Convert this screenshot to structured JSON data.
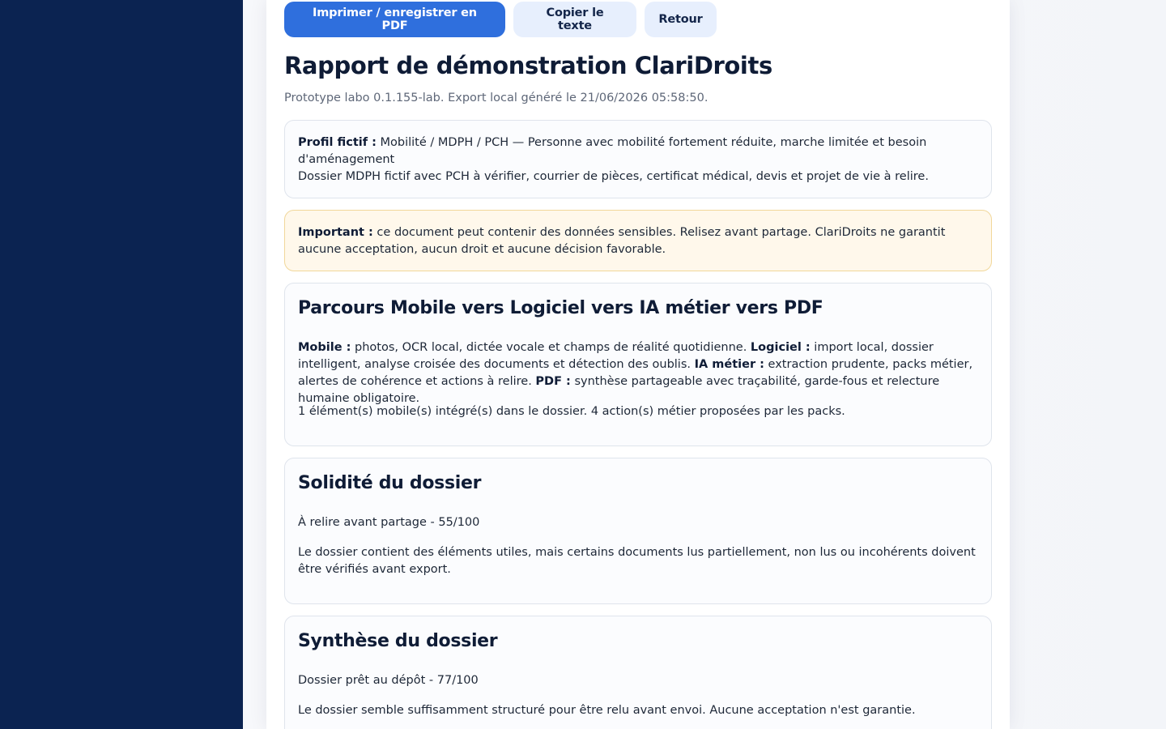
{
  "toolbar": {
    "print_label": "Imprimer / enregistrer en PDF",
    "copy_label": "Copier le texte",
    "back_label": "Retour"
  },
  "header": {
    "title": "Rapport de démonstration ClariDroits",
    "subtitle": "Prototype labo 0.1.155-lab. Export local généré le 21/06/2026 05:58:50."
  },
  "profile": {
    "label": "Profil fictif :",
    "summary": " Mobilité / MDPH / PCH — Personne avec mobilité fortement réduite, marche limitée et besoin d'aménagement",
    "detail": "Dossier MDPH fictif avec PCH à vérifier, courrier de pièces, certificat médical, devis et projet de vie à relire."
  },
  "warning": {
    "label": "Important :",
    "text": " ce document peut contenir des données sensibles. Relisez avant partage. ClariDroits ne garantit aucune acceptation, aucun droit et aucune décision favorable."
  },
  "parcours": {
    "title": "Parcours Mobile vers Logiciel vers IA métier vers PDF",
    "mobile_label": "Mobile :",
    "mobile_text": " photos, OCR local, dictée vocale et champs de réalité quotidienne. ",
    "logiciel_label": "Logiciel :",
    "logiciel_text": " import local, dossier intelligent, analyse croisée des documents et détection des oublis. ",
    "ia_label": "IA métier :",
    "ia_text": " extraction prudente, packs métier, alertes de cohérence et actions à relire. ",
    "pdf_label": "PDF :",
    "pdf_text": " synthèse partageable avec traçabilité, garde-fous et relecture humaine obligatoire.",
    "summary": "1 élément(s) mobile(s) intégré(s) dans le dossier. 4 action(s) métier proposées par les packs."
  },
  "solidite": {
    "title": "Solidité du dossier",
    "status": "À relire avant partage - 55/100",
    "text": "Le dossier contient des éléments utiles, mais certains documents lus partiellement, non lus ou incohérents doivent être vérifiés avant export."
  },
  "synthese": {
    "title": "Synthèse du dossier",
    "status": "Dossier prêt au dépôt - 77/100",
    "text": "Le dossier semble suffisamment structuré pour être relu avant envoi. Aucune acceptation n'est garantie."
  }
}
